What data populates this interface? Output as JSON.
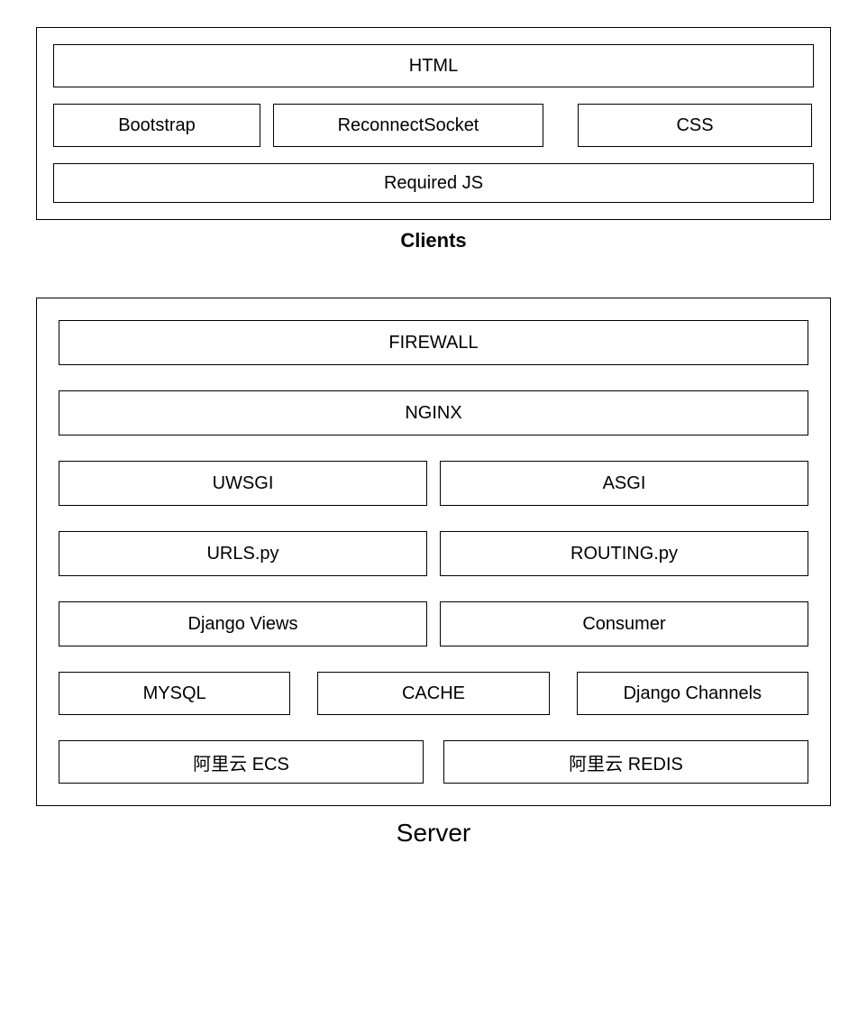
{
  "clients": {
    "label": "Clients",
    "html": "HTML",
    "bootstrap": "Bootstrap",
    "reconnect": "ReconnectSocket",
    "css": "CSS",
    "required_js": "Required JS"
  },
  "server": {
    "label": "Server",
    "firewall": "FIREWALL",
    "nginx": "NGINX",
    "uwsgi": "UWSGI",
    "asgi": "ASGI",
    "urls": "URLS.py",
    "routing": "ROUTING.py",
    "views": "Django Views",
    "consumer": "Consumer",
    "mysql": "MYSQL",
    "cache": "CACHE",
    "channels": "Django Channels",
    "ecs": "阿里云 ECS",
    "redis": "阿里云 REDIS"
  }
}
